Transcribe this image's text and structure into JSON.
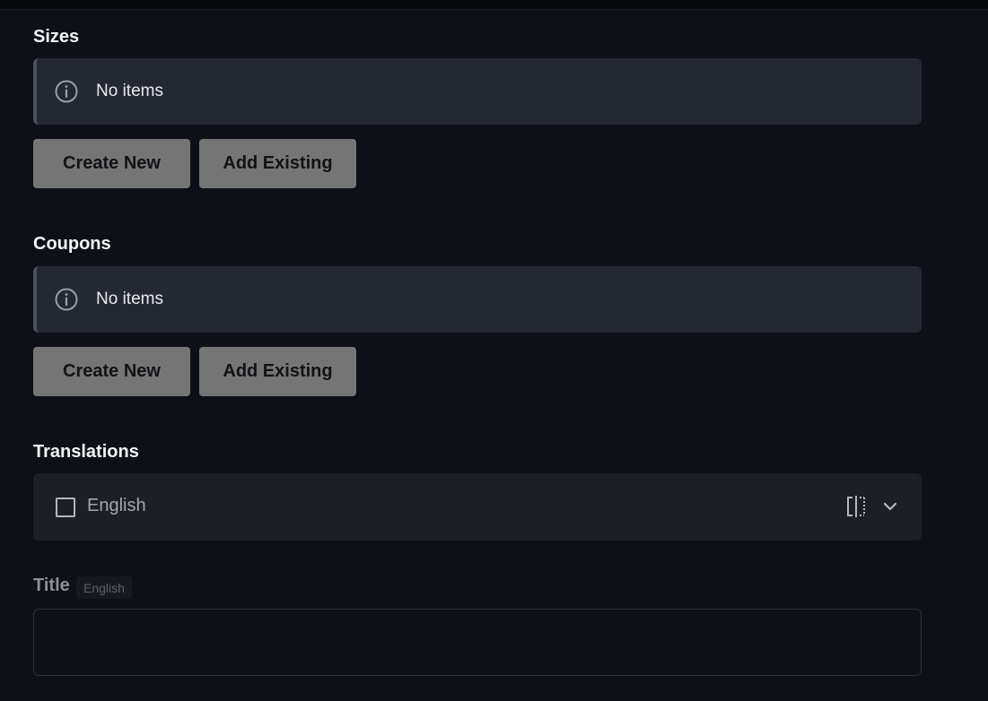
{
  "sections": [
    {
      "title": "Sizes",
      "empty_text": "No items",
      "create_label": "Create New",
      "existing_label": "Add Existing"
    },
    {
      "title": "Coupons",
      "empty_text": "No items",
      "create_label": "Create New",
      "existing_label": "Add Existing"
    }
  ],
  "translations": {
    "title": "Translations",
    "languages": [
      {
        "label": "English",
        "checked": false
      }
    ]
  },
  "title_field": {
    "label": "Title",
    "language_badge": "English",
    "value": "",
    "placeholder": ""
  },
  "colors": {
    "background": "#0d1016",
    "notice_bg": "#242832",
    "button_bg": "#757575"
  }
}
